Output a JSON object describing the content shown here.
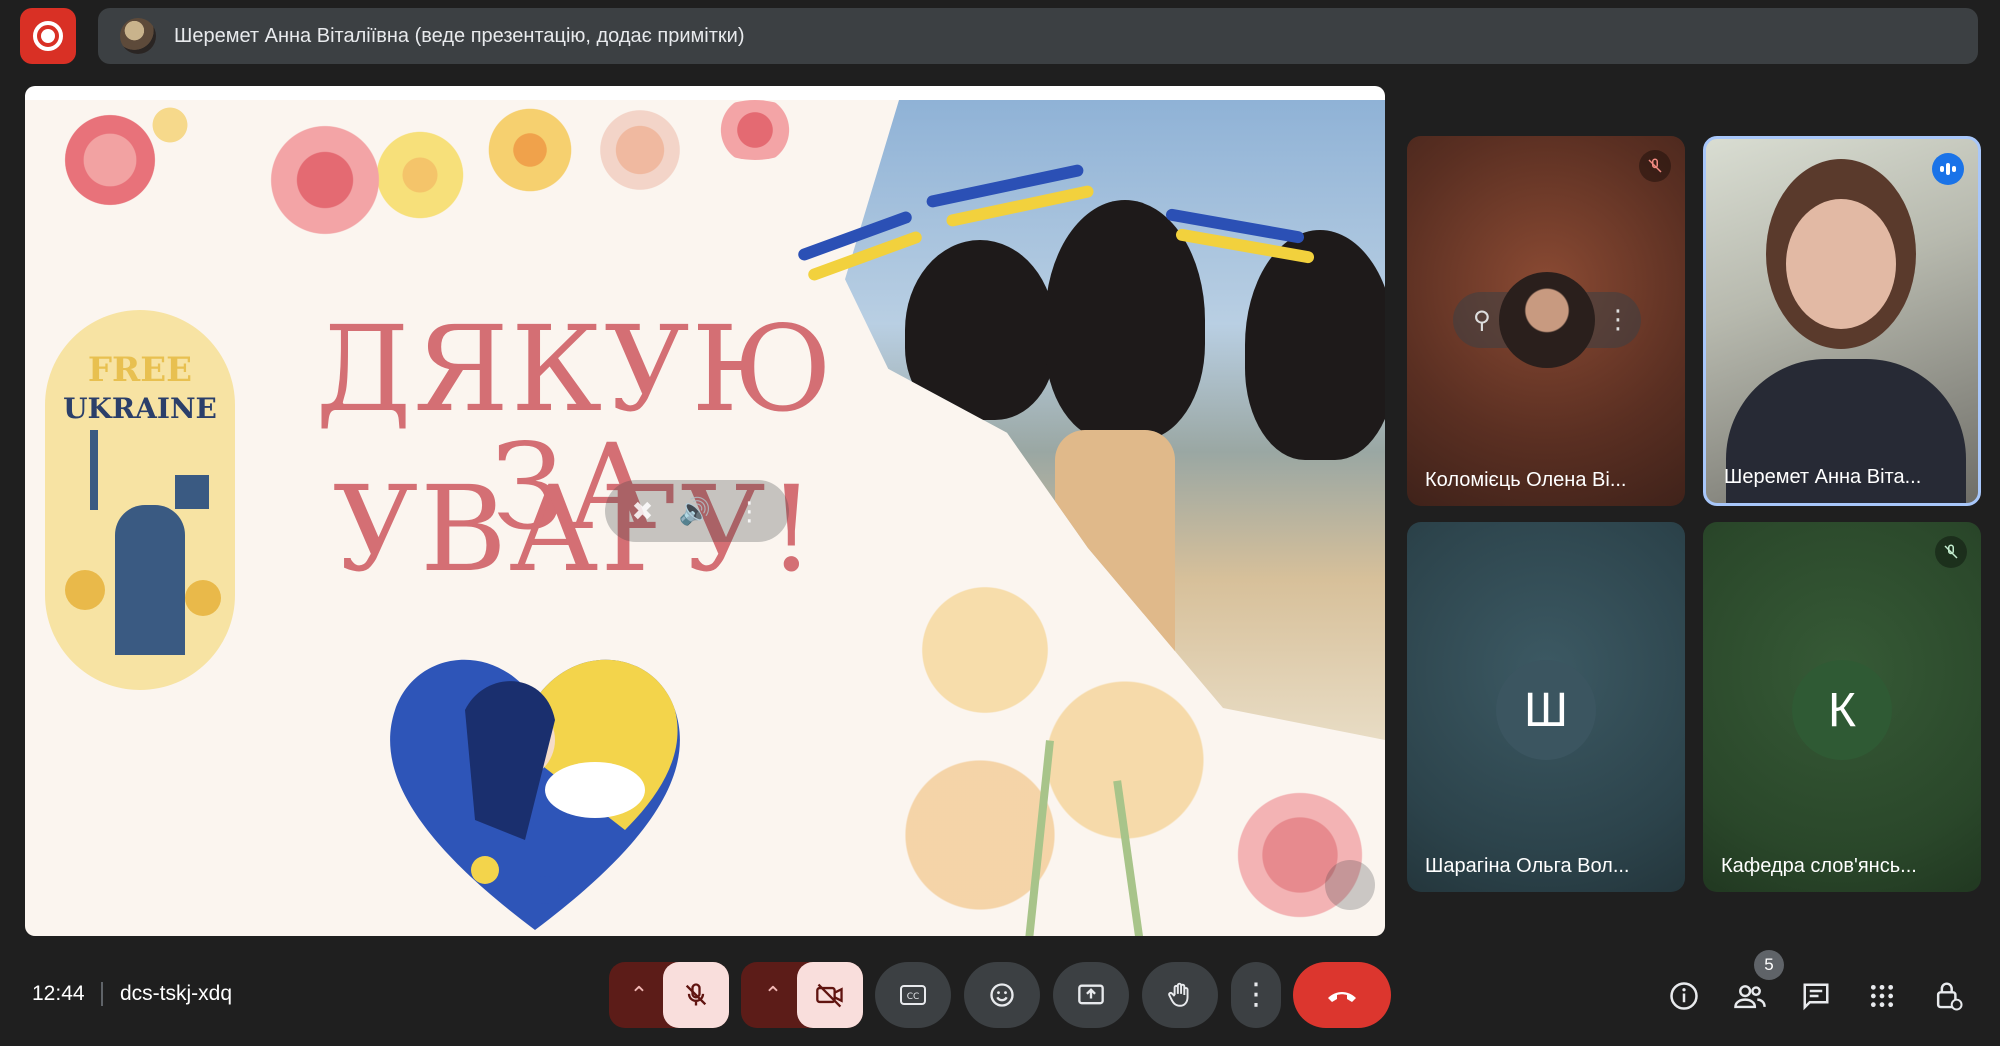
{
  "top_bar": {
    "record_icon": "record-icon",
    "presenter_text": "Шеремет Анна Віталіївна (веде презентацію, додає примітки)"
  },
  "slide": {
    "title_line1": "ДЯКУЮ ЗА",
    "title_line2": "УВАГУ!",
    "badge_line1": "FREE",
    "badge_line2": "UKRAINE",
    "accent_color": "#d46f74"
  },
  "tiles": [
    {
      "name": "Коломієць Олена Ві...",
      "muted": true,
      "bg": "#7a4230"
    },
    {
      "name": "Шеремет Анна Віта...",
      "speaking": true,
      "bg": "#bfc3b7"
    },
    {
      "name": "Шарагіна Ольга Вол...",
      "initial": "Ш",
      "bg": "#35505a"
    },
    {
      "name": "Кафедра слов'янсь...",
      "initial": "К",
      "muted": true,
      "bg": "#2f4a2f"
    }
  ],
  "bottom_bar": {
    "time": "12:44",
    "meeting_code": "dcs-tskj-xdq",
    "people_count": "5"
  }
}
